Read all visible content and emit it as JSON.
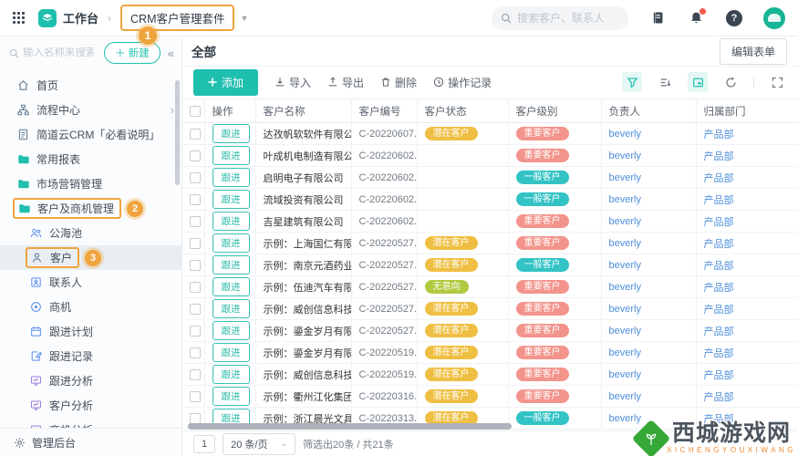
{
  "topbar": {
    "workspace_label": "工作台",
    "app_tab_label": "CRM客户管理套件",
    "search_placeholder": "搜索客户、联系人"
  },
  "annotations": {
    "step1": "1",
    "step2": "2",
    "step3": "3"
  },
  "sidebar": {
    "search_placeholder": "输入名称来搜索",
    "new_button_label": "＋ 新建",
    "collapse_icon": "«",
    "footer_label": "管理后台",
    "items": [
      {
        "label": "首页",
        "icon": "home",
        "color": "#5f7b95",
        "indent": 0
      },
      {
        "label": "流程中心",
        "icon": "flow",
        "color": "#5f7b95",
        "indent": 0,
        "chevron": true
      },
      {
        "label": "简道云CRM「必看说明」",
        "icon": "doc",
        "color": "#5f7b95",
        "indent": 0
      },
      {
        "label": "常用报表",
        "icon": "folder",
        "color": "#21bfad",
        "indent": 0
      },
      {
        "label": "市场营销管理",
        "icon": "folder",
        "color": "#21bfad",
        "indent": 0
      },
      {
        "label": "客户及商机管理",
        "icon": "folder",
        "color": "#21bfad",
        "indent": 0,
        "boxed": true,
        "badge": "2"
      },
      {
        "label": "公海池",
        "icon": "users",
        "color": "#5b8def",
        "indent": 1
      },
      {
        "label": "客户",
        "icon": "user",
        "color": "#5f7b95",
        "indent": 1,
        "selected": true,
        "boxed": true,
        "badge": "3"
      },
      {
        "label": "联系人",
        "icon": "contact",
        "color": "#5b8def",
        "indent": 1
      },
      {
        "label": "商机",
        "icon": "target",
        "color": "#5b8def",
        "indent": 1
      },
      {
        "label": "跟进计划",
        "icon": "plan",
        "color": "#5b8def",
        "indent": 1
      },
      {
        "label": "跟进记录",
        "icon": "record",
        "color": "#5b8def",
        "indent": 1
      },
      {
        "label": "跟进分析",
        "icon": "chart",
        "color": "#9b7ede",
        "indent": 1
      },
      {
        "label": "客户分析",
        "icon": "chart",
        "color": "#9b7ede",
        "indent": 1
      },
      {
        "label": "商机分析",
        "icon": "chart",
        "color": "#9b7ede",
        "indent": 1
      }
    ]
  },
  "main": {
    "view_title": "全部",
    "edit_form_label": "编辑表单",
    "toolbar": {
      "add_label": "添加",
      "import_label": "导入",
      "export_label": "导出",
      "delete_label": "删除",
      "log_label": "操作记录"
    },
    "table": {
      "headers": [
        "操作",
        "客户名称",
        "客户编号",
        "客户状态",
        "客户级别",
        "负责人",
        "归属部门"
      ],
      "action_label": "跟进",
      "rows": [
        {
          "name": "达孜帆软软件有限公...",
          "code": "C-20220607...",
          "status": "潜在客户",
          "status_type": "yellow",
          "level": "重要客户",
          "level_type": "red",
          "owner": "beverly",
          "dept": "产品部"
        },
        {
          "name": "叶成机电制造有限公...",
          "code": "C-20220602...",
          "status": "",
          "status_type": "",
          "level": "重要客户",
          "level_type": "red",
          "owner": "beverly",
          "dept": "产品部"
        },
        {
          "name": "启明电子有限公司",
          "code": "C-20220602...",
          "status": "",
          "status_type": "",
          "level": "一般客户",
          "level_type": "teal",
          "owner": "beverly",
          "dept": "产品部"
        },
        {
          "name": "流域投资有限公司",
          "code": "C-20220602...",
          "status": "",
          "status_type": "",
          "level": "一般客户",
          "level_type": "teal",
          "owner": "beverly",
          "dept": "产品部"
        },
        {
          "name": "吉星建筑有限公司",
          "code": "C-20220602...",
          "status": "",
          "status_type": "",
          "level": "重要客户",
          "level_type": "red",
          "owner": "beverly",
          "dept": "产品部"
        },
        {
          "name": "示例：上海国仁有限...",
          "code": "C-20220527...",
          "status": "潜在客户",
          "status_type": "yellow",
          "level": "重要客户",
          "level_type": "red",
          "owner": "beverly",
          "dept": "产品部"
        },
        {
          "name": "示例：南京元酒药业",
          "code": "C-20220527...",
          "status": "潜在客户",
          "status_type": "yellow",
          "level": "一般客户",
          "level_type": "teal",
          "owner": "beverly",
          "dept": "产品部"
        },
        {
          "name": "示例：伍迪汽车有限...",
          "code": "C-20220527...",
          "status": "无意向",
          "status_type": "green",
          "level": "重要客户",
          "level_type": "red",
          "owner": "beverly",
          "dept": "产品部"
        },
        {
          "name": "示例：威创信息科技...",
          "code": "C-20220527...",
          "status": "潜在客户",
          "status_type": "yellow",
          "level": "重要客户",
          "level_type": "red",
          "owner": "beverly",
          "dept": "产品部"
        },
        {
          "name": "示例：鎏金岁月有限...",
          "code": "C-20220527...",
          "status": "潜在客户",
          "status_type": "yellow",
          "level": "重要客户",
          "level_type": "red",
          "owner": "beverly",
          "dept": "产品部"
        },
        {
          "name": "示例：鎏金岁月有限...",
          "code": "C-20220519...",
          "status": "潜在客户",
          "status_type": "yellow",
          "level": "重要客户",
          "level_type": "red",
          "owner": "beverly",
          "dept": "产品部"
        },
        {
          "name": "示例：威创信息科技...",
          "code": "C-20220519...",
          "status": "潜在客户",
          "status_type": "yellow",
          "level": "重要客户",
          "level_type": "red",
          "owner": "beverly",
          "dept": "产品部"
        },
        {
          "name": "示例：衢州江化集团",
          "code": "C-20220316...",
          "status": "潜在客户",
          "status_type": "yellow",
          "level": "重要客户",
          "level_type": "red",
          "owner": "beverly",
          "dept": "产品部"
        },
        {
          "name": "示例：浙江晨光文具...",
          "code": "C-20220313...",
          "status": "潜在客户",
          "status_type": "yellow",
          "level": "一般客户",
          "level_type": "teal",
          "owner": "beverly",
          "dept": "产品部"
        }
      ]
    },
    "pagination": {
      "page": "1",
      "page_size": "20 条/页",
      "summary": "筛选出20条 / 共21条"
    }
  },
  "watermark": {
    "title": "西城游戏网",
    "subtitle": "XICHENGYOUXIWANG"
  },
  "colors": {
    "primary_teal": "#1fbfae",
    "annotation_orange": "#f0a43e",
    "badge_yellow": "#efbf43",
    "badge_green": "#b0ca40",
    "badge_red": "#f2948b",
    "badge_teal": "#33c3c5",
    "link_blue": "#4e8fdb"
  }
}
